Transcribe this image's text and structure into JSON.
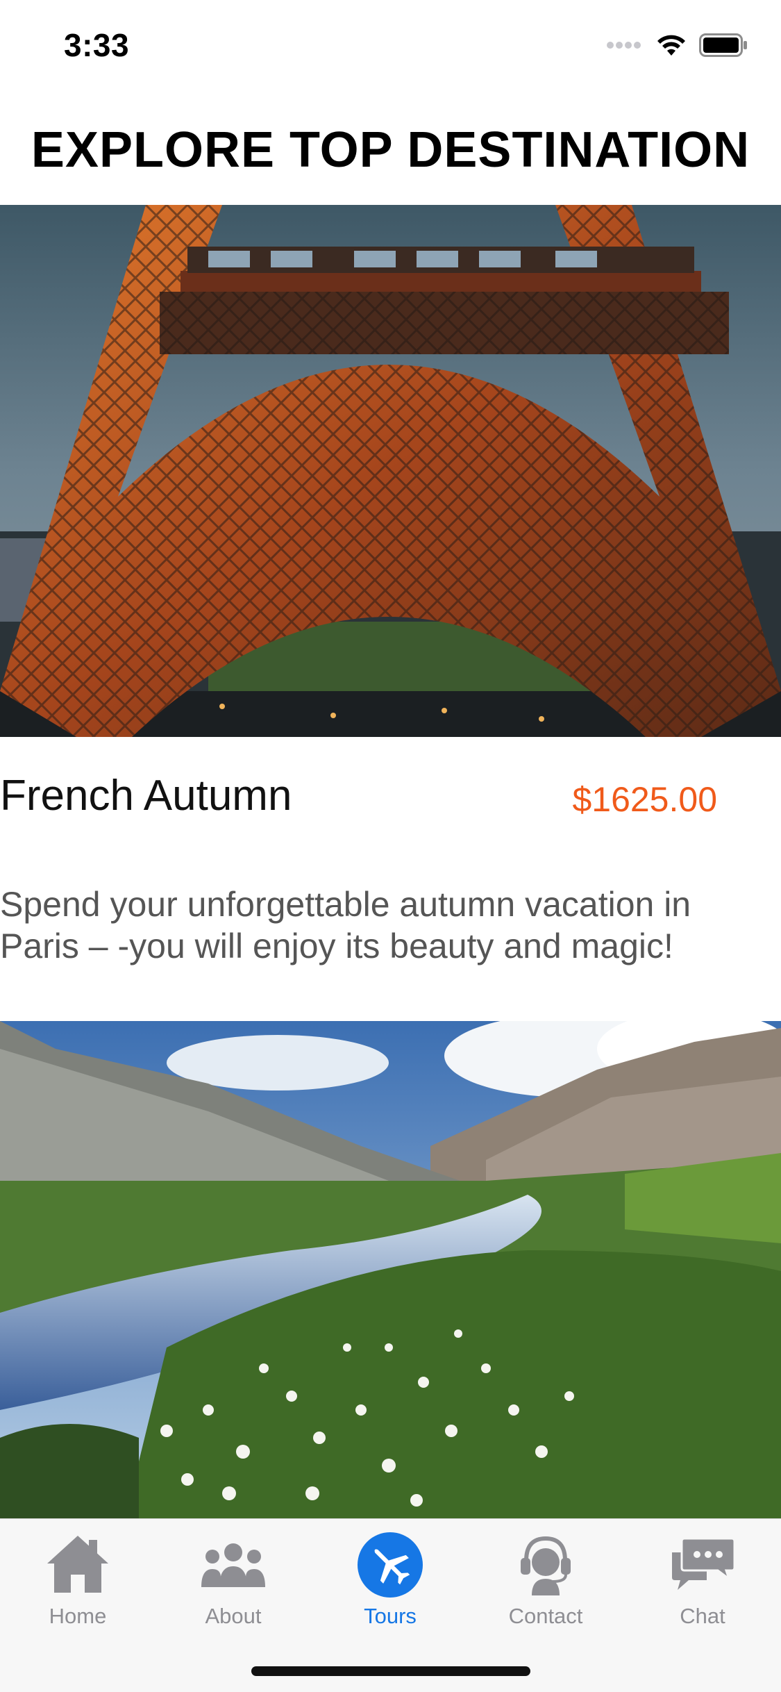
{
  "status_bar": {
    "time": "3:33"
  },
  "header": {
    "title": "EXPLORE TOP DESTINATION"
  },
  "tours": [
    {
      "title": "French Autumn",
      "price": "$1625.00",
      "description": "Spend your unforgettable autumn vacation in Paris – -you will enjoy its beauty and magic!"
    }
  ],
  "tab_bar": {
    "items": [
      {
        "label": "Home",
        "icon": "home-icon",
        "active": false
      },
      {
        "label": "About",
        "icon": "people-icon",
        "active": false
      },
      {
        "label": "Tours",
        "icon": "airplane-icon",
        "active": true
      },
      {
        "label": "Contact",
        "icon": "support-agent-icon",
        "active": false
      },
      {
        "label": "Chat",
        "icon": "chat-bubbles-icon",
        "active": false
      }
    ]
  },
  "colors": {
    "accent": "#1677e5",
    "price": "#f05a1a",
    "tab_inactive": "#8e8e93"
  }
}
